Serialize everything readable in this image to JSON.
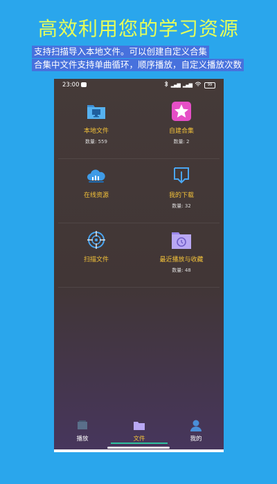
{
  "headline": "高效利用您的学习资源",
  "captions": {
    "line1": "支持扫描导入本地文件。可以创建自定义合集",
    "line2": "合集中文件支持单曲循环，顺序播放，自定义播放次数"
  },
  "status_bar": {
    "time": "23:00",
    "battery": "99",
    "icons": [
      "app-notification-icon",
      "bluetooth-icon",
      "signal-icon",
      "signal-icon",
      "wifi-icon",
      "battery-icon"
    ]
  },
  "grid": {
    "local_files": {
      "label": "本地文件",
      "count": "数量: 559"
    },
    "custom_collection": {
      "label": "自建合集",
      "count": "数量: 2"
    },
    "online_resources": {
      "label": "在线资源"
    },
    "my_downloads": {
      "label": "我的下载",
      "count": "数量: 32"
    },
    "scan_files": {
      "label": "扫描文件"
    },
    "recent_and_favorites": {
      "label": "最近播放与收藏",
      "count": "数量: 48"
    }
  },
  "tabs": [
    {
      "label": "播放",
      "icon": "playlist-icon",
      "active": false
    },
    {
      "label": "文件",
      "icon": "folder-icon",
      "active": true
    },
    {
      "label": "我的",
      "icon": "user-icon",
      "active": false
    }
  ],
  "colors": {
    "background": "#2aa6ec",
    "headline": "#e6ff5a",
    "caption_highlight": "#5f46d2",
    "label": "#f3c23a",
    "active_tab_underline": "#2ec4a0"
  }
}
